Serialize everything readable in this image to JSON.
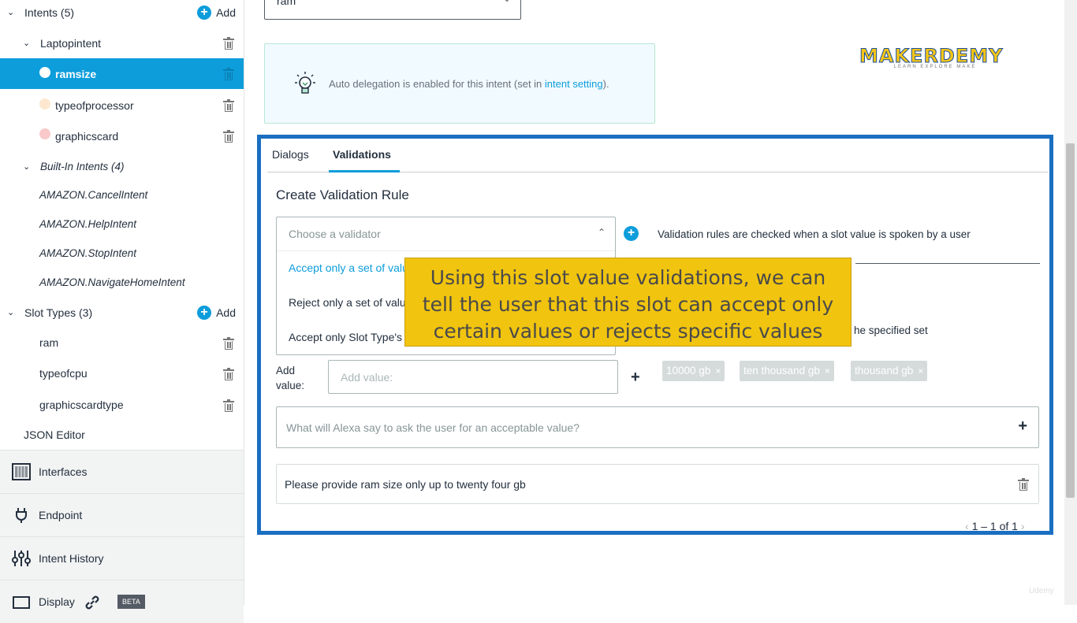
{
  "sidebar": {
    "intents_header": "Intents (5)",
    "add_label": "Add",
    "custom_intent": "Laptopintent",
    "slots": [
      {
        "label": "ramsize",
        "color": "#ffffff"
      },
      {
        "label": "typeofprocessor",
        "color": "#fde8cf"
      },
      {
        "label": "graphicscard",
        "color": "#f9c9c9"
      }
    ],
    "builtin_header": "Built-In Intents (4)",
    "builtin_intents": [
      "AMAZON.CancelIntent",
      "AMAZON.HelpIntent",
      "AMAZON.StopIntent",
      "AMAZON.NavigateHomeIntent"
    ],
    "slot_types_header": "Slot Types (3)",
    "slot_types": [
      "ram",
      "typeofcpu",
      "graphicscardtype"
    ],
    "json_editor": "JSON Editor",
    "nav": {
      "interfaces": "Interfaces",
      "endpoint": "Endpoint",
      "intent_history": "Intent History",
      "display": "Display",
      "beta": "BETA"
    }
  },
  "main": {
    "slot_type_select": "ram",
    "info_text": "Auto delegation is enabled for this intent (set in ",
    "info_link": "intent setting",
    "info_tail": ").",
    "logo_text": "MAKERDEMY",
    "logo_sub": "LEARN EXPLORE MAKE",
    "tabs": [
      "Dialogs",
      "Validations"
    ],
    "section_title": "Create Validation Rule",
    "validator_placeholder": "Choose a validator",
    "validator_options": [
      "Accept only a set of valu",
      "Reject only a set of valu",
      "Accept only Slot Type's v"
    ],
    "rule_hint": "Validation rules are checked when a slot value is spoken by a user",
    "specified_set_text": "he specified set",
    "add_value_label": "Add value:",
    "add_value_placeholder": "Add value:",
    "chips": [
      "10000 gb",
      "ten thousand gb",
      "thousand gb"
    ],
    "prompt_placeholder": "What will Alexa say to ask the user for an acceptable value?",
    "prompt_response": "Please provide ram size only up to twenty four gb",
    "pager": "1 – 1 of 1"
  },
  "caption": "Using this slot value validations, we can tell the user that this slot can accept only certain values or rejects specific values",
  "watermark": "Udemy"
}
